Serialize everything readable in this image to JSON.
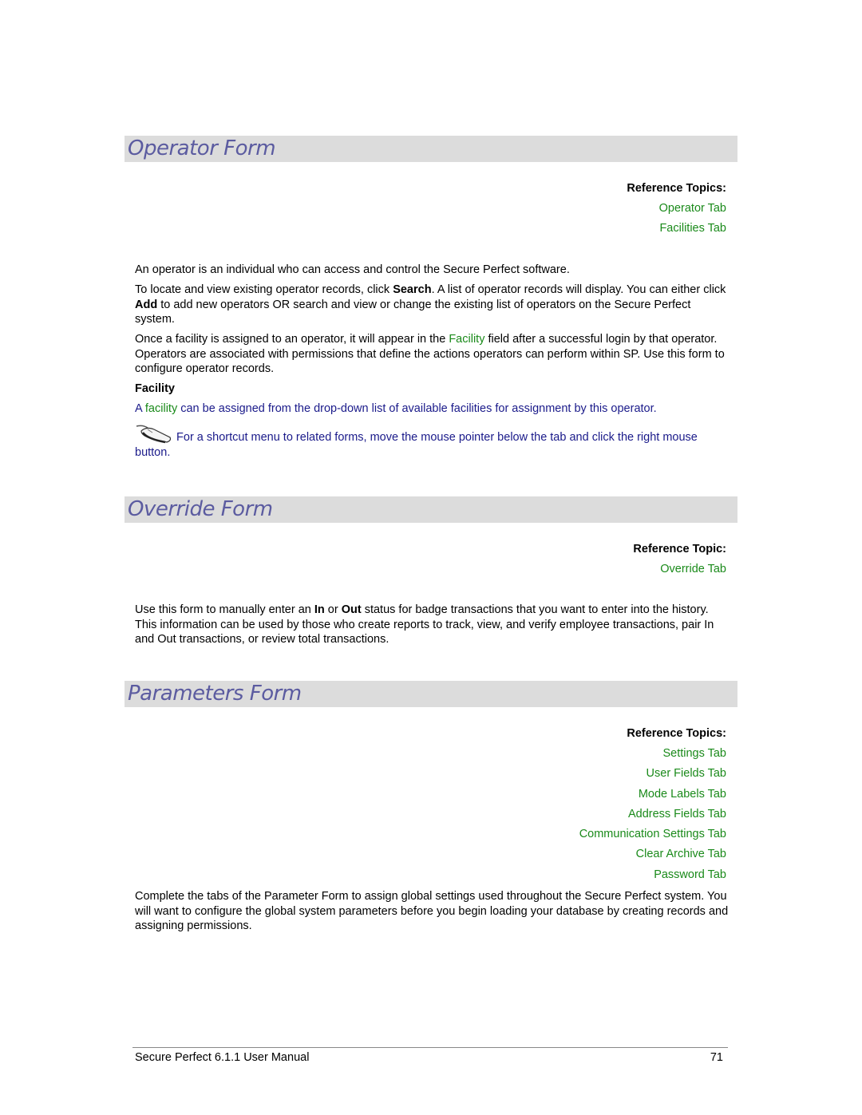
{
  "sections": {
    "operator": {
      "title": "Operator Form",
      "ref_title": "Reference Topics:",
      "ref_links": [
        "Operator Tab",
        "Facilities Tab"
      ],
      "p1": "An operator is an individual who can access and control the Secure Perfect software.",
      "p2": {
        "a": "To locate and view existing operator records, click ",
        "b_search": "Search",
        "c": ". A list of operator records will display. You can either click ",
        "d_add": "Add",
        "e": " to add new operators OR search and view or change the existing list of operators on the Secure Perfect system."
      },
      "p3": {
        "a": "Once a facility is assigned to an operator, it will appear in the ",
        "link": "Facility",
        "b": " field after a successful login by that operator. Operators are associated with permissions that define the actions operators can perform within SP. Use this form to configure operator records."
      },
      "facility_heading": "Facility",
      "facility_text": {
        "a": "A ",
        "link": "facility",
        "b": " can be assigned from the drop-down list of available facilities for assignment by this operator."
      },
      "tip_icon": "mouse-icon",
      "tip_text": " For a shortcut menu to related forms, move the mouse pointer below the tab and click the right mouse button."
    },
    "override": {
      "title": "Override Form",
      "ref_title": "Reference Topic:",
      "ref_links": [
        "Override Tab"
      ],
      "p1": {
        "a": "Use this form to manually enter an ",
        "b_in": "In",
        "c": " or ",
        "d_out": "Out",
        "e": " status for badge transactions that you want to enter into the history. This information can be used by those who create reports to track, view, and verify employee transactions, pair In and Out transactions, or review total transactions."
      }
    },
    "parameters": {
      "title": "Parameters Form",
      "ref_title": "Reference Topics:",
      "ref_links": [
        "Settings Tab",
        "User Fields Tab",
        "Mode Labels Tab",
        "Address Fields Tab",
        "Communication Settings Tab",
        "Clear Archive Tab",
        "Password Tab"
      ],
      "p1": "Complete the tabs of the Parameter Form to assign global settings used throughout the Secure Perfect system. You will want to configure the global system parameters before you begin loading your database by creating records and assigning permissions."
    }
  },
  "footer": {
    "title": "Secure Perfect 6.1.1 User Manual",
    "page_number": "71"
  },
  "colors": {
    "heading_text": "#5b5ba0",
    "heading_bg": "#dcdcdc",
    "link": "#1a8a1a",
    "note_text": "#1a1a8a"
  }
}
